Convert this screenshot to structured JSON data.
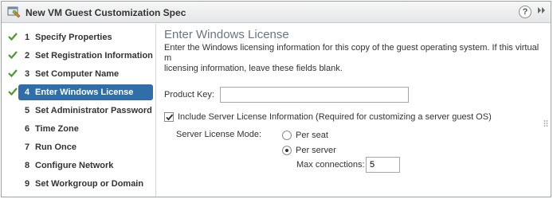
{
  "window": {
    "title": "New VM Guest Customization Spec",
    "help_symbol": "?",
    "expand_symbol": "⏩"
  },
  "sidebar": {
    "steps": [
      {
        "num": "1",
        "label": "Specify Properties",
        "completed": true,
        "active": false
      },
      {
        "num": "2",
        "label": "Set Registration Information",
        "completed": true,
        "active": false
      },
      {
        "num": "3",
        "label": "Set Computer Name",
        "completed": true,
        "active": false
      },
      {
        "num": "4",
        "label": "Enter Windows License",
        "completed": true,
        "active": true
      },
      {
        "num": "5",
        "label": "Set Administrator Password",
        "completed": false,
        "active": false
      },
      {
        "num": "6",
        "label": "Time Zone",
        "completed": false,
        "active": false
      },
      {
        "num": "7",
        "label": "Run Once",
        "completed": false,
        "active": false
      },
      {
        "num": "8",
        "label": "Configure Network",
        "completed": false,
        "active": false
      },
      {
        "num": "9",
        "label": "Set Workgroup or Domain",
        "completed": false,
        "active": false
      }
    ]
  },
  "main": {
    "title": "Enter Windows License",
    "description": "Enter the Windows licensing information for this copy of the guest operating system. If this virtual m\nlicensing information, leave these fields blank.",
    "product_key_label": "Product Key:",
    "product_key_value": "",
    "include_server_license_label": "Include Server License Information (Required for customizing a server guest OS)",
    "include_server_license_checked": true,
    "server_license_mode_label": "Server License Mode:",
    "per_seat_label": "Per seat",
    "per_server_label": "Per server",
    "selected_mode": "Per server",
    "max_connections_label": "Max connections:",
    "max_connections_value": "5"
  },
  "colors": {
    "accent": "#2f6ea8",
    "check_green": "#4a9a2e",
    "title_gray": "#6a7682"
  }
}
